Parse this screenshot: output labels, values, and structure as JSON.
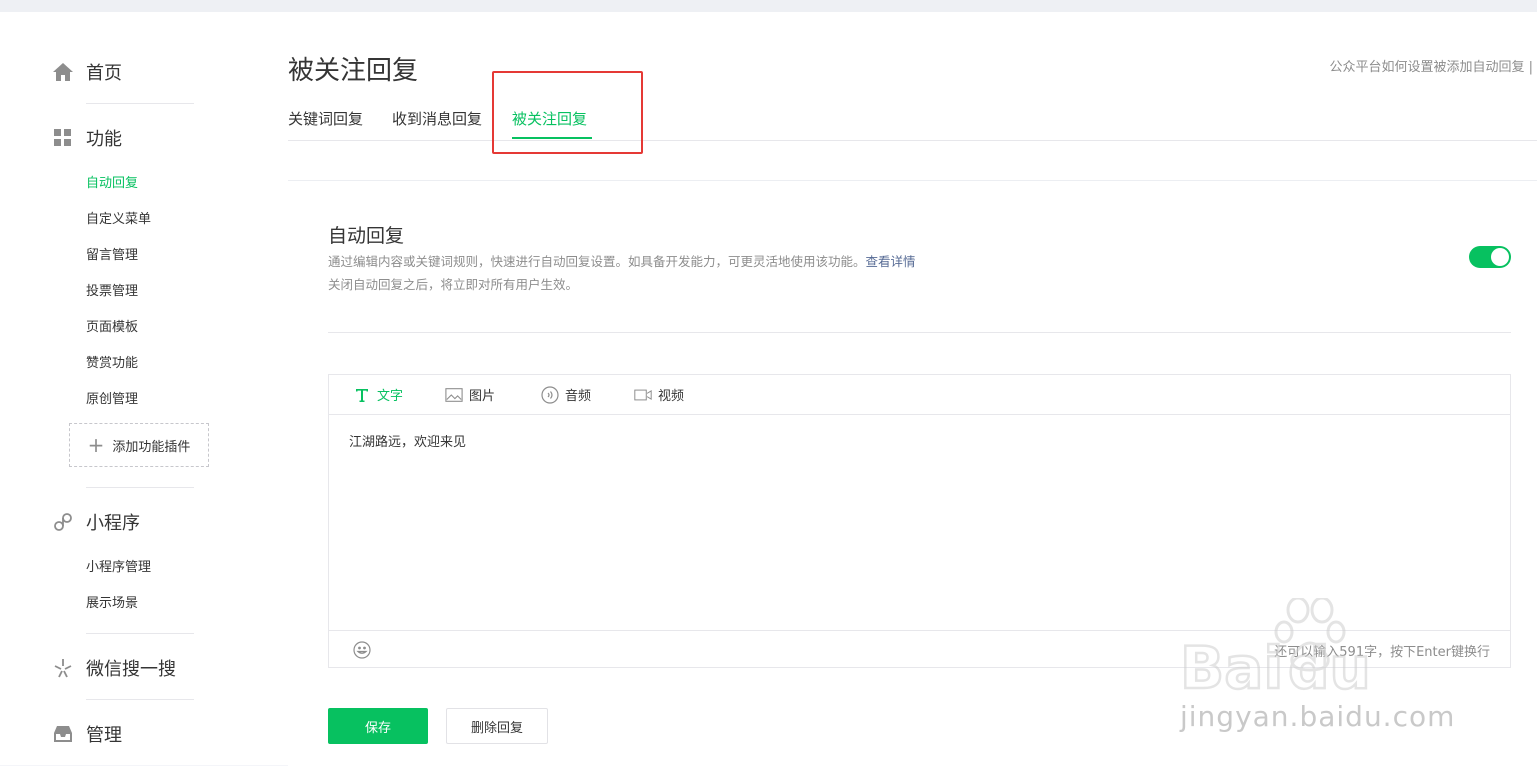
{
  "sidebar": {
    "home": {
      "label": "首页",
      "icon": "home-icon"
    },
    "features": {
      "label": "功能",
      "icon": "grid-icon",
      "items": [
        "自动回复",
        "自定义菜单",
        "留言管理",
        "投票管理",
        "页面模板",
        "赞赏功能",
        "原创管理"
      ],
      "active_item": "自动回复",
      "add_plugin_label": "添加功能插件"
    },
    "miniprogram": {
      "label": "小程序",
      "icon": "link-icon",
      "items": [
        "小程序管理",
        "展示场景"
      ]
    },
    "search": {
      "label": "微信搜一搜",
      "icon": "sparkle-icon"
    },
    "manage": {
      "label": "管理",
      "icon": "inbox-icon"
    }
  },
  "header": {
    "title": "被关注回复",
    "help_link": "公众平台如何设置被添加自动回复 |",
    "tabs": [
      "关键词回复",
      "收到消息回复",
      "被关注回复"
    ],
    "active_tab": "被关注回复"
  },
  "card": {
    "title": "自动回复",
    "desc_line1": "通过编辑内容或关键词规则，快速进行自动回复设置。如具备开发能力，可更灵活地使用该功能。",
    "desc_link": "查看详情",
    "desc_line2": "关闭自动回复之后，将立即对所有用户生效。",
    "toggle_on": true,
    "accent_color": "#07c160"
  },
  "editor": {
    "tabs": [
      {
        "label": "文字",
        "icon": "text-icon"
      },
      {
        "label": "图片",
        "icon": "image-icon"
      },
      {
        "label": "音频",
        "icon": "audio-icon"
      },
      {
        "label": "视频",
        "icon": "video-icon"
      }
    ],
    "active_tab": "文字",
    "content": "江湖路远，欢迎来见",
    "char_hint": "还可以输入591字，按下Enter键换行"
  },
  "buttons": {
    "save": "保存",
    "delete": "删除回复"
  },
  "watermark": {
    "text": "jingyan.baidu.com"
  }
}
